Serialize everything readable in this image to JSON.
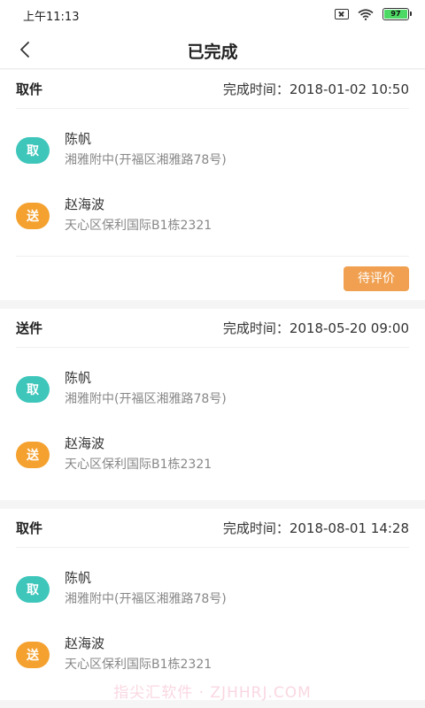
{
  "status_bar": {
    "time": "上午11:13",
    "battery_level": "97",
    "battery_color": "#4cd964"
  },
  "nav": {
    "title": "已完成",
    "back_icon": "chevron-left-icon"
  },
  "orders": [
    {
      "type": "取件",
      "time_label": "完成时间：2018-01-02 10:50",
      "stops": [
        {
          "badge": "取",
          "name": "陈帆",
          "address": "湘雅附中(开福区湘雅路78号)"
        },
        {
          "badge": "送",
          "name": "赵海波",
          "address": "天心区保利国际B1栋2321"
        }
      ],
      "action": "待评价"
    },
    {
      "type": "送件",
      "time_label": "完成时间：2018-05-20 09:00",
      "stops": [
        {
          "badge": "取",
          "name": "陈帆",
          "address": "湘雅附中(开福区湘雅路78号)"
        },
        {
          "badge": "送",
          "name": "赵海波",
          "address": "天心区保利国际B1栋2321"
        }
      ]
    },
    {
      "type": "取件",
      "time_label": "完成时间：2018-08-01 14:28",
      "stops": [
        {
          "badge": "取",
          "name": "陈帆",
          "address": "湘雅附中(开福区湘雅路78号)"
        },
        {
          "badge": "送",
          "name": "赵海波",
          "address": "天心区保利国际B1栋2321"
        }
      ]
    }
  ],
  "colors": {
    "pick_badge": "#3ec6bb",
    "send_badge": "#f4a12f",
    "action_button": "#f0a050"
  },
  "watermark": "指尖汇软件 · ZJHHRJ.COM"
}
